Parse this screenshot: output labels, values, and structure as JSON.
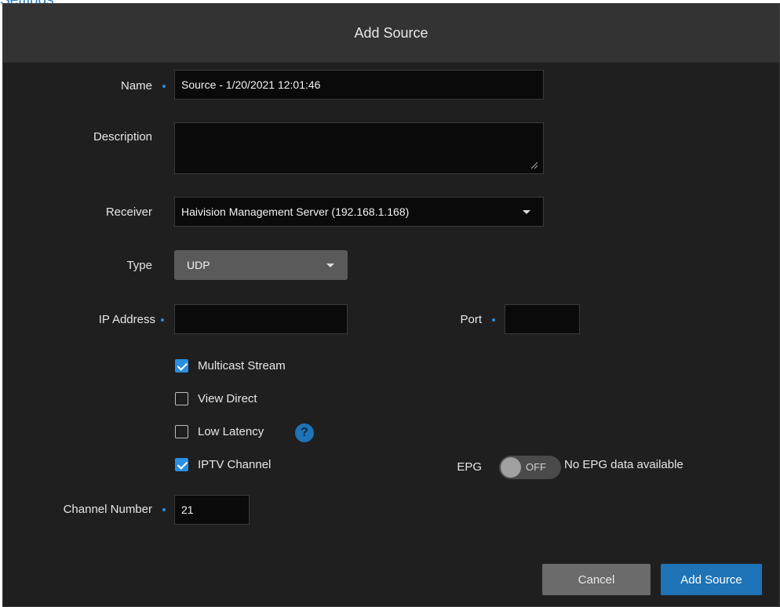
{
  "breadcrumb": {
    "text": "Settings",
    "punct": "."
  },
  "dialog": {
    "title": "Add Source"
  },
  "form": {
    "name": {
      "label": "Name",
      "value": "Source - 1/20/2021 12:01:46"
    },
    "description": {
      "label": "Description",
      "value": ""
    },
    "receiver": {
      "label": "Receiver",
      "value": "Haivision Management Server (192.168.1.168)"
    },
    "type": {
      "label": "Type",
      "value": "UDP"
    },
    "ip_address": {
      "label": "IP Address",
      "value": ""
    },
    "port": {
      "label": "Port",
      "value": ""
    },
    "multicast": {
      "label": "Multicast Stream",
      "checked": true
    },
    "view_direct": {
      "label": "View Direct",
      "checked": false
    },
    "low_latency": {
      "label": "Low Latency",
      "checked": false,
      "help_icon": "help-icon",
      "help_glyph": "?"
    },
    "iptv_channel": {
      "label": "IPTV Channel",
      "checked": true
    },
    "epg": {
      "label": "EPG",
      "toggle_text": "OFF",
      "note": "No EPG data available"
    },
    "channel_number": {
      "label": "Channel Number",
      "value": "21"
    }
  },
  "footer": {
    "cancel_label": "Cancel",
    "submit_label": "Add Source"
  },
  "colors": {
    "accent": "#1f73b7",
    "required_dot": "#2a8fe0",
    "panel": "#1f1f1f",
    "titlebar": "#333333"
  }
}
